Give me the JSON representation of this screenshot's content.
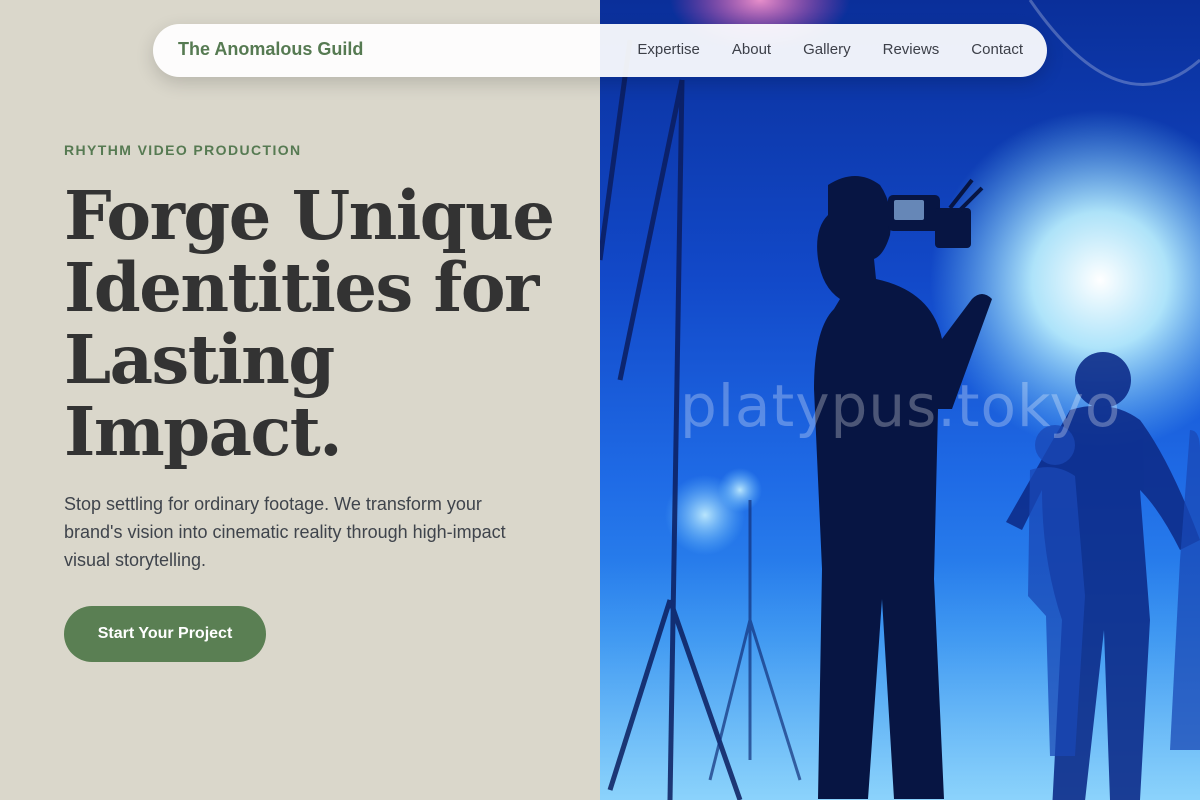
{
  "nav": {
    "brand": "The Anomalous Guild",
    "links": [
      "Expertise",
      "About",
      "Gallery",
      "Reviews",
      "Contact"
    ]
  },
  "hero": {
    "eyebrow": "RHYTHM VIDEO PRODUCTION",
    "headline": "Forge Unique Identities for Lasting Impact.",
    "subtext": "Stop settling for ordinary footage. We transform your brand's vision into cinematic reality through high-impact visual storytelling.",
    "cta_label": "Start Your Project"
  },
  "image": {
    "watermark": "platypus.tokyo"
  },
  "colors": {
    "accent": "#5a7f53",
    "background": "#dad7cb",
    "heading": "#333333"
  }
}
